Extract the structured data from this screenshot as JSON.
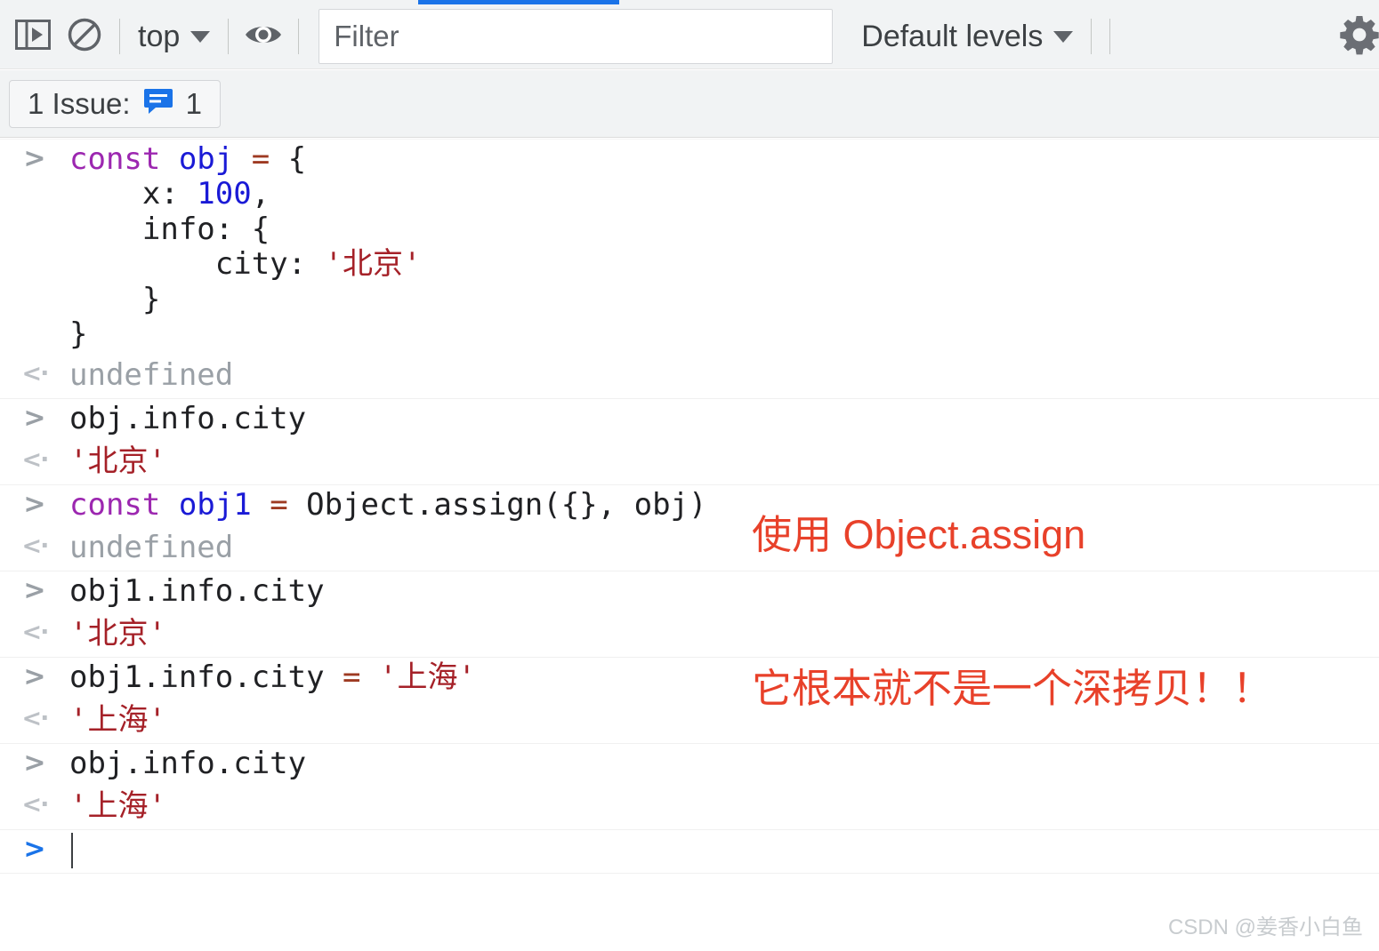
{
  "toolbar": {
    "sidebar_toggle_title": "Show console sidebar",
    "clear_console_title": "Clear console",
    "context_selector": "top",
    "eye_title": "Create live expression",
    "filter_placeholder": "Filter",
    "filter_value": "",
    "levels_selector": "Default levels",
    "settings_title": "Console settings",
    "accent_color": "#1a73e8"
  },
  "issues": {
    "label": "1 Issue:",
    "count": "1",
    "badge_color": "#1a73e8"
  },
  "console": {
    "groups": [
      {
        "rows": [
          {
            "kind": "input",
            "marker": ">",
            "lines": [
              [
                {
                  "t": "const ",
                  "c": "t-kw"
                },
                {
                  "t": "obj ",
                  "c": "t-var"
                },
                {
                  "t": "= ",
                  "c": "t-op"
                },
                {
                  "t": "{",
                  "c": "t-plain"
                }
              ],
              [
                {
                  "t": "    x: ",
                  "c": "t-plain"
                },
                {
                  "t": "100",
                  "c": "t-num"
                },
                {
                  "t": ",",
                  "c": "t-plain"
                }
              ],
              [
                {
                  "t": "    info: {",
                  "c": "t-plain"
                }
              ],
              [
                {
                  "t": "        city: ",
                  "c": "t-plain"
                },
                {
                  "t": "'北京'",
                  "c": "t-str"
                }
              ],
              [
                {
                  "t": "    }",
                  "c": "t-plain"
                }
              ],
              [
                {
                  "t": "}",
                  "c": "t-plain"
                }
              ]
            ]
          },
          {
            "kind": "output",
            "marker": "<·",
            "lines": [
              [
                {
                  "t": "undefined",
                  "c": "t-undef"
                }
              ]
            ]
          }
        ]
      },
      {
        "rows": [
          {
            "kind": "input",
            "marker": ">",
            "lines": [
              [
                {
                  "t": "obj.info.city",
                  "c": "t-plain"
                }
              ]
            ]
          },
          {
            "kind": "output",
            "marker": "<·",
            "lines": [
              [
                {
                  "t": "'北京'",
                  "c": "t-str"
                }
              ]
            ]
          }
        ]
      },
      {
        "rows": [
          {
            "kind": "input",
            "marker": ">",
            "lines": [
              [
                {
                  "t": "const ",
                  "c": "t-kw"
                },
                {
                  "t": "obj1 ",
                  "c": "t-var"
                },
                {
                  "t": "= ",
                  "c": "t-op"
                },
                {
                  "t": "Object.assign({}, obj)",
                  "c": "t-plain"
                }
              ]
            ]
          },
          {
            "kind": "output",
            "marker": "<·",
            "lines": [
              [
                {
                  "t": "undefined",
                  "c": "t-undef"
                }
              ]
            ]
          }
        ]
      },
      {
        "rows": [
          {
            "kind": "input",
            "marker": ">",
            "lines": [
              [
                {
                  "t": "obj1.info.city",
                  "c": "t-plain"
                }
              ]
            ]
          },
          {
            "kind": "output",
            "marker": "<·",
            "lines": [
              [
                {
                  "t": "'北京'",
                  "c": "t-str"
                }
              ]
            ]
          }
        ]
      },
      {
        "rows": [
          {
            "kind": "input",
            "marker": ">",
            "lines": [
              [
                {
                  "t": "obj1.info.city ",
                  "c": "t-plain"
                },
                {
                  "t": "= ",
                  "c": "t-op"
                },
                {
                  "t": "'上海'",
                  "c": "t-str"
                }
              ]
            ]
          },
          {
            "kind": "output",
            "marker": "<·",
            "lines": [
              [
                {
                  "t": "'上海'",
                  "c": "t-str"
                }
              ]
            ]
          }
        ]
      },
      {
        "rows": [
          {
            "kind": "input",
            "marker": ">",
            "lines": [
              [
                {
                  "t": "obj.info.city",
                  "c": "t-plain"
                }
              ]
            ]
          },
          {
            "kind": "output",
            "marker": "<·",
            "lines": [
              [
                {
                  "t": "'上海'",
                  "c": "t-str"
                }
              ]
            ]
          }
        ]
      },
      {
        "rows": [
          {
            "kind": "prompt",
            "marker": ">",
            "lines": [
              [
                {
                  "t": "",
                  "c": "t-plain"
                }
              ]
            ]
          }
        ]
      }
    ]
  },
  "annotation": {
    "line1": "使用 Object.assign",
    "line2": "它根本就不是一个深拷贝！！",
    "color": "#e8412a"
  },
  "watermark": {
    "text": "CSDN @姜香小白鱼"
  }
}
